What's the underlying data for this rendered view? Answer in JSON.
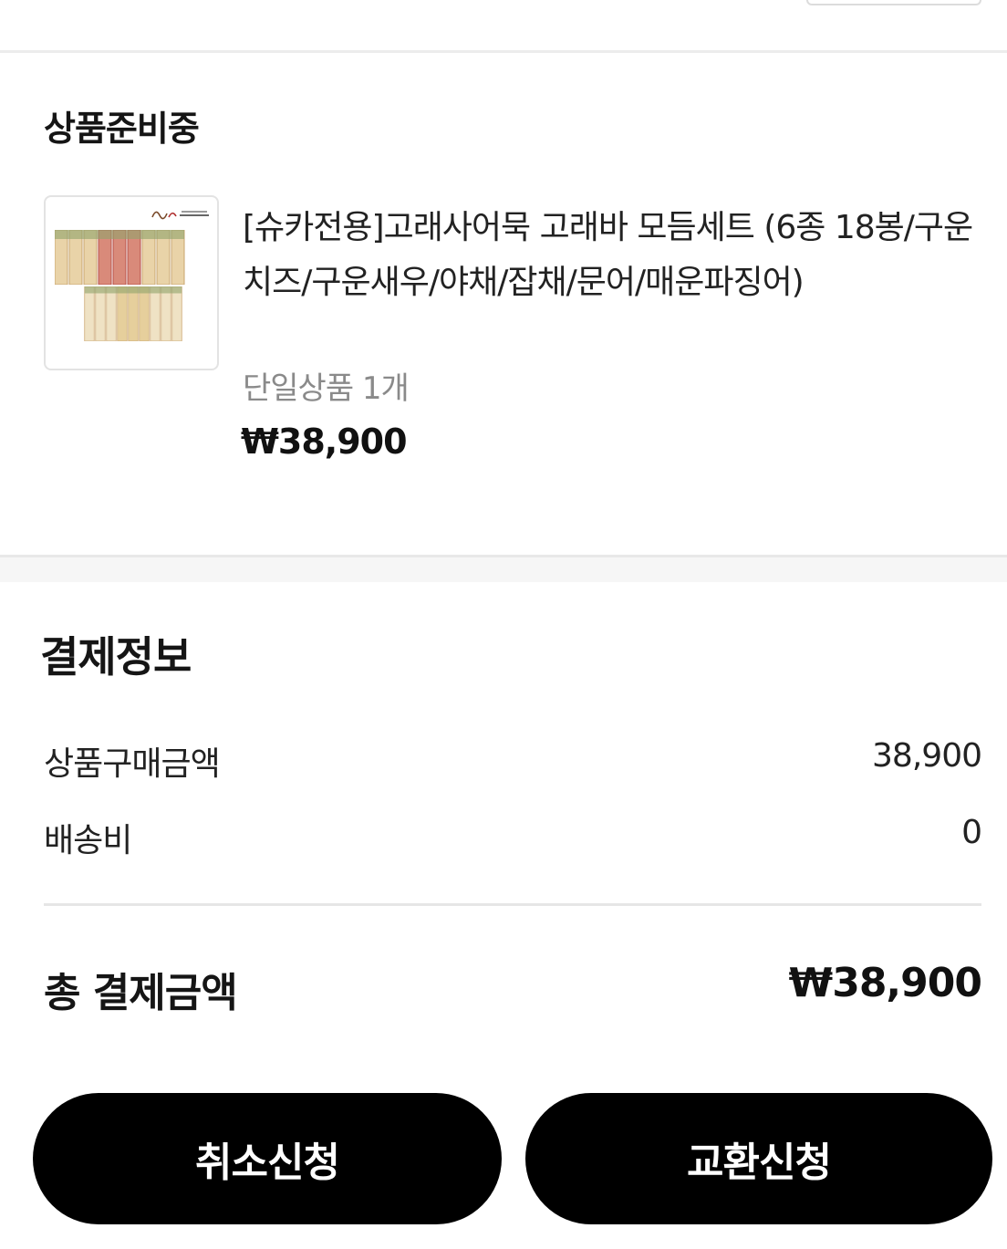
{
  "order": {
    "status": "상품준비중",
    "item": {
      "name": "[슈카전용]고래사어묵 고래바 모듬세트 (6종 18봉/구운치즈/구운새우/야채/잡채/문어/매운파징어)",
      "option": "단일상품 1개",
      "price": "₩38,900",
      "thumbnail": "fishcake-bar-set-image"
    }
  },
  "payment": {
    "title": "결제정보",
    "rows": [
      {
        "label": "상품구매금액",
        "value": "38,900"
      },
      {
        "label": "배송비",
        "value": "0"
      }
    ],
    "total_label": "총 결제금액",
    "total_value": "₩38,900"
  },
  "actions": {
    "cancel_label": "취소신청",
    "exchange_label": "교환신청"
  },
  "colors": {
    "button_bg": "#000000",
    "button_text": "#ffffff",
    "muted_text": "#8a8a8a",
    "divider": "#e6e6e6"
  }
}
